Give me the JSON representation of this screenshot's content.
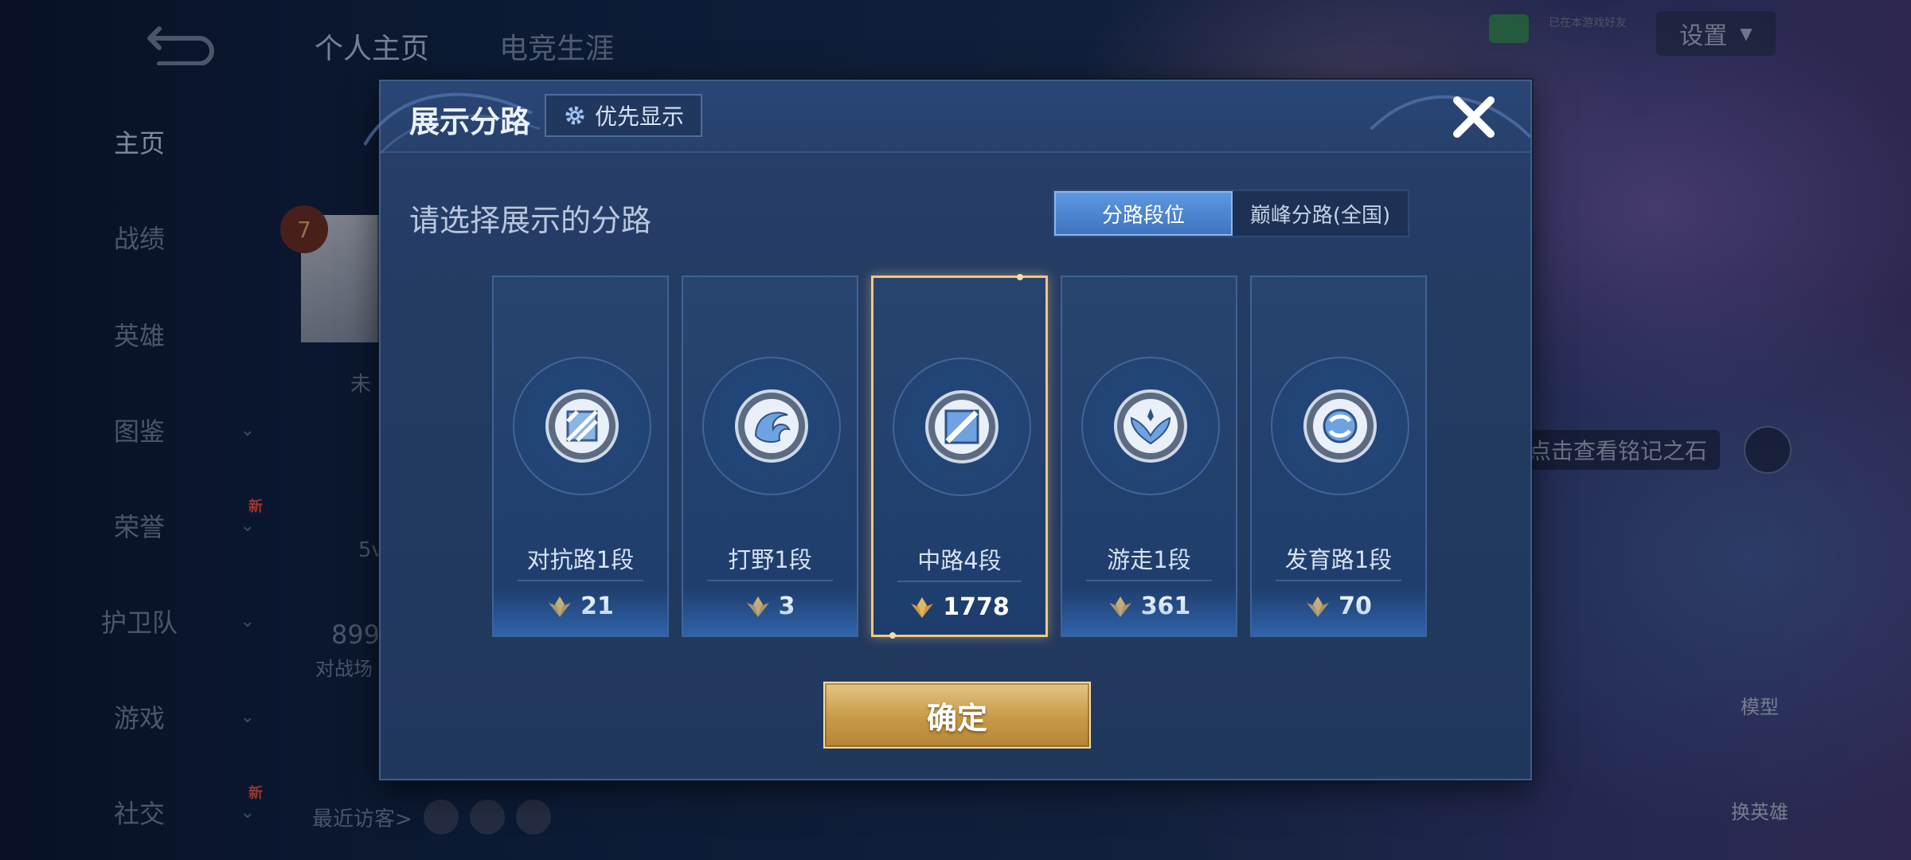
{
  "background": {
    "top_tabs": [
      "个人主页",
      "电竞生涯"
    ],
    "settings_label": "设置",
    "wechat_text": "已在本游戏好友",
    "nav": [
      {
        "label": "主页",
        "active": true,
        "chevron": false,
        "new": false
      },
      {
        "label": "战绩",
        "active": false,
        "chevron": false,
        "new": false
      },
      {
        "label": "英雄",
        "active": false,
        "chevron": false,
        "new": false
      },
      {
        "label": "图鉴",
        "active": false,
        "chevron": true,
        "new": false
      },
      {
        "label": "荣誉",
        "active": false,
        "chevron": true,
        "new": true
      },
      {
        "label": "护卫队",
        "active": false,
        "chevron": true,
        "new": false
      },
      {
        "label": "游戏",
        "active": false,
        "chevron": true,
        "new": false
      },
      {
        "label": "社交",
        "active": false,
        "chevron": true,
        "new": true
      }
    ],
    "new_badge": "新",
    "level": "7",
    "side_text_1": "未",
    "side_text_2": "5v",
    "side_text_3": "899",
    "side_text_4": "对战场",
    "stone_hint": "点击查看铭记之石",
    "model_label": "模型",
    "change_hero_label": "换英雄",
    "recent_visitors": "最近访客>"
  },
  "modal": {
    "title": "展示分路",
    "priority_label": "优先显示",
    "subtitle": "请选择展示的分路",
    "toggle": [
      "分路段位",
      "巅峰分路(全国)"
    ],
    "lanes": [
      {
        "label": "对抗路1段",
        "score": "21",
        "icon": "clash-lane-icon",
        "selected": false
      },
      {
        "label": "打野1段",
        "score": "3",
        "icon": "jungle-icon",
        "selected": false
      },
      {
        "label": "中路4段",
        "score": "1778",
        "icon": "mid-lane-icon",
        "selected": true
      },
      {
        "label": "游走1段",
        "score": "361",
        "icon": "roam-icon",
        "selected": false
      },
      {
        "label": "发育路1段",
        "score": "70",
        "icon": "farm-lane-icon",
        "selected": false
      }
    ],
    "confirm_label": "确定"
  },
  "colors": {
    "accent_gold": "#d4aa5e",
    "selected_border": "#f0c780",
    "toggle_active": "#4a82cc"
  }
}
